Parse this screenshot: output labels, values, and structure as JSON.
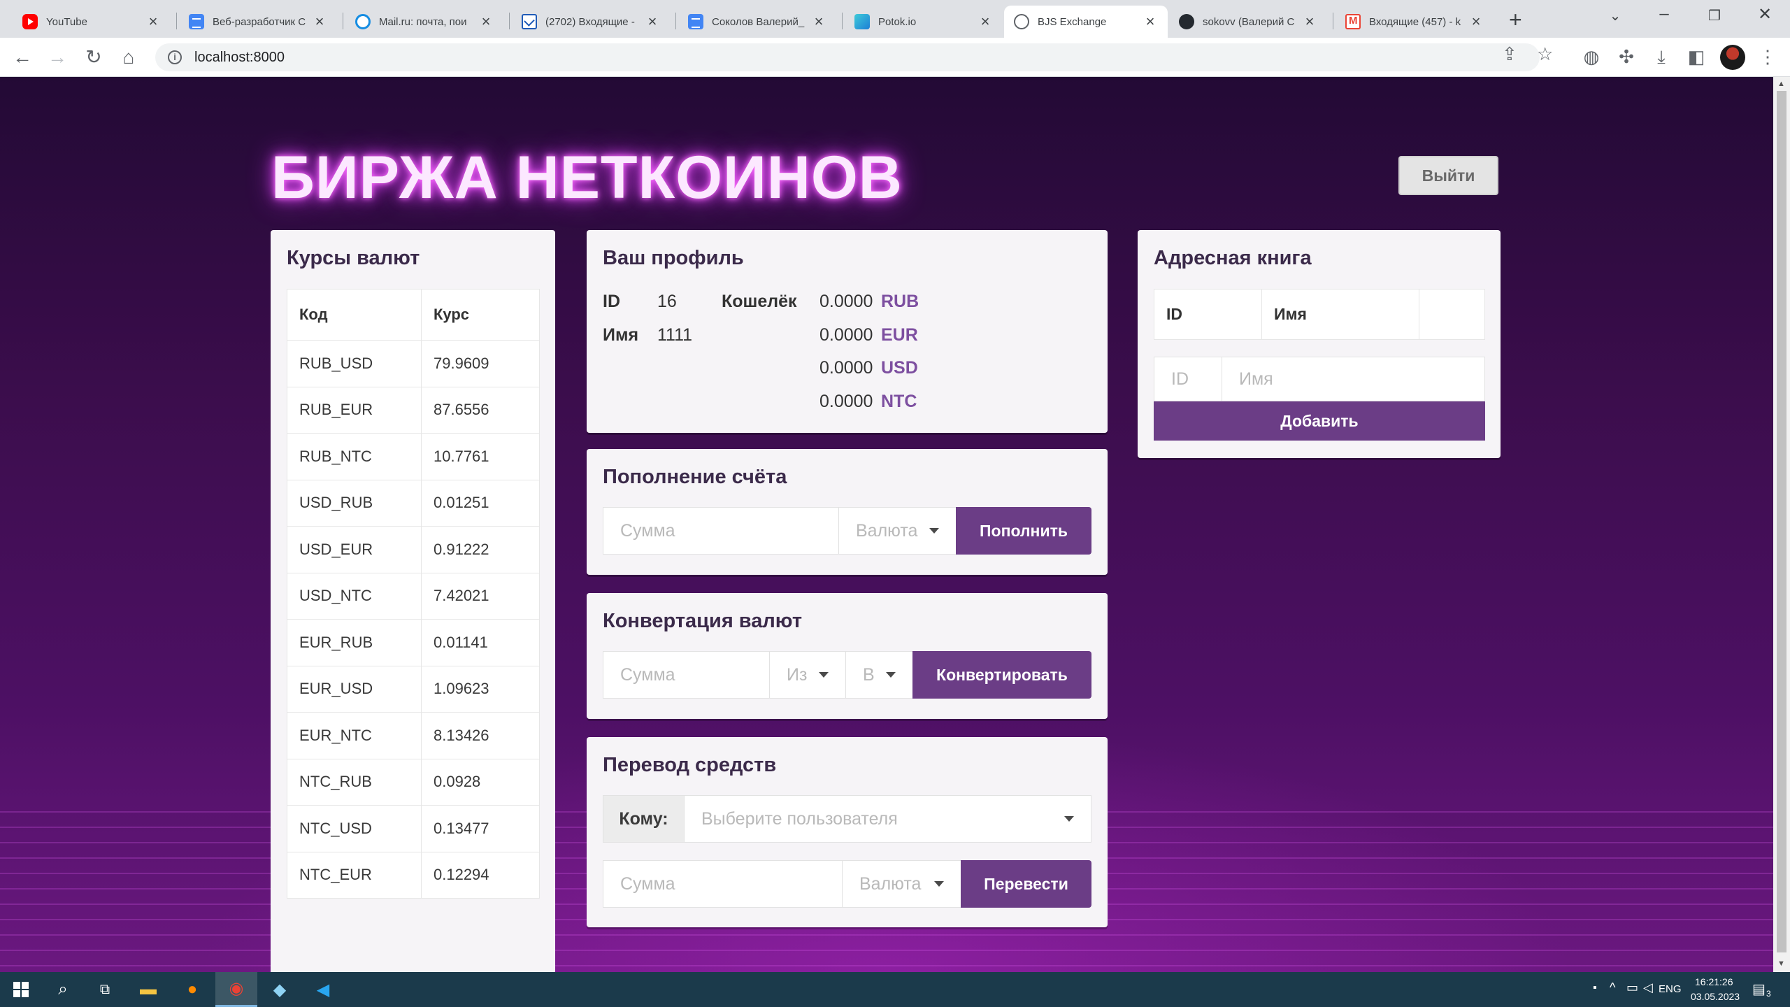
{
  "browser": {
    "tabs": [
      {
        "title": "YouTube",
        "favicon": "youtube-icon"
      },
      {
        "title": "Веб-разработчик С",
        "favicon": "google-docs-icon"
      },
      {
        "title": "Mail.ru: почта, пои",
        "favicon": "mailru-icon"
      },
      {
        "title": "(2702) Входящие -",
        "favicon": "outlook-icon"
      },
      {
        "title": "Соколов Валерий_",
        "favicon": "google-docs-icon"
      },
      {
        "title": "Potok.io",
        "favicon": "potok-icon"
      },
      {
        "title": "BJS Exchange",
        "favicon": "globe-icon",
        "active": true
      },
      {
        "title": "sokovv (Валерий С",
        "favicon": "github-icon"
      },
      {
        "title": "Входящие (457) - k",
        "favicon": "gmail-icon"
      }
    ],
    "url": "localhost:8000"
  },
  "page": {
    "title": "БИРЖА НЕТКОИНОВ",
    "logout_label": "Выйти"
  },
  "rates": {
    "heading": "Курсы валют",
    "columns": [
      "Код",
      "Курс"
    ],
    "rows": [
      {
        "code": "RUB_USD",
        "rate": "79.9609"
      },
      {
        "code": "RUB_EUR",
        "rate": "87.6556"
      },
      {
        "code": "RUB_NTC",
        "rate": "10.7761"
      },
      {
        "code": "USD_RUB",
        "rate": "0.01251"
      },
      {
        "code": "USD_EUR",
        "rate": "0.91222"
      },
      {
        "code": "USD_NTC",
        "rate": "7.42021"
      },
      {
        "code": "EUR_RUB",
        "rate": "0.01141"
      },
      {
        "code": "EUR_USD",
        "rate": "1.09623"
      },
      {
        "code": "EUR_NTC",
        "rate": "8.13426"
      },
      {
        "code": "NTC_RUB",
        "rate": "0.0928"
      },
      {
        "code": "NTC_USD",
        "rate": "0.13477"
      },
      {
        "code": "NTC_EUR",
        "rate": "0.12294"
      }
    ]
  },
  "profile": {
    "heading": "Ваш профиль",
    "id_label": "ID",
    "id_value": "16",
    "name_label": "Имя",
    "name_value": "1111",
    "wallet_label": "Кошелёк",
    "wallet": [
      {
        "amount": "0.0000",
        "currency": "RUB"
      },
      {
        "amount": "0.0000",
        "currency": "EUR"
      },
      {
        "amount": "0.0000",
        "currency": "USD"
      },
      {
        "amount": "0.0000",
        "currency": "NTC"
      }
    ]
  },
  "deposit": {
    "heading": "Пополнение счёта",
    "amount_placeholder": "Сумма",
    "currency_placeholder": "Валюта",
    "button": "Пополнить"
  },
  "convert": {
    "heading": "Конвертация валют",
    "amount_placeholder": "Сумма",
    "from_placeholder": "Из",
    "to_placeholder": "В",
    "button": "Конвертировать"
  },
  "transfer": {
    "heading": "Перевод средств",
    "to_label": "Кому:",
    "user_placeholder": "Выберите пользователя",
    "amount_placeholder": "Сумма",
    "currency_placeholder": "Валюта",
    "button": "Перевести"
  },
  "address_book": {
    "heading": "Адресная книга",
    "columns": [
      "ID",
      "Имя"
    ],
    "id_placeholder": "ID",
    "name_placeholder": "Имя",
    "add_button": "Добавить"
  },
  "taskbar": {
    "language": "ENG",
    "time": "16:21:26",
    "date": "03.05.2023",
    "notifications": "3"
  },
  "colors": {
    "accent": "#6b3d86",
    "currency_text": "#7d4fa0",
    "title_glow": "#e04ff5",
    "page_background": "#3b0d4c"
  }
}
